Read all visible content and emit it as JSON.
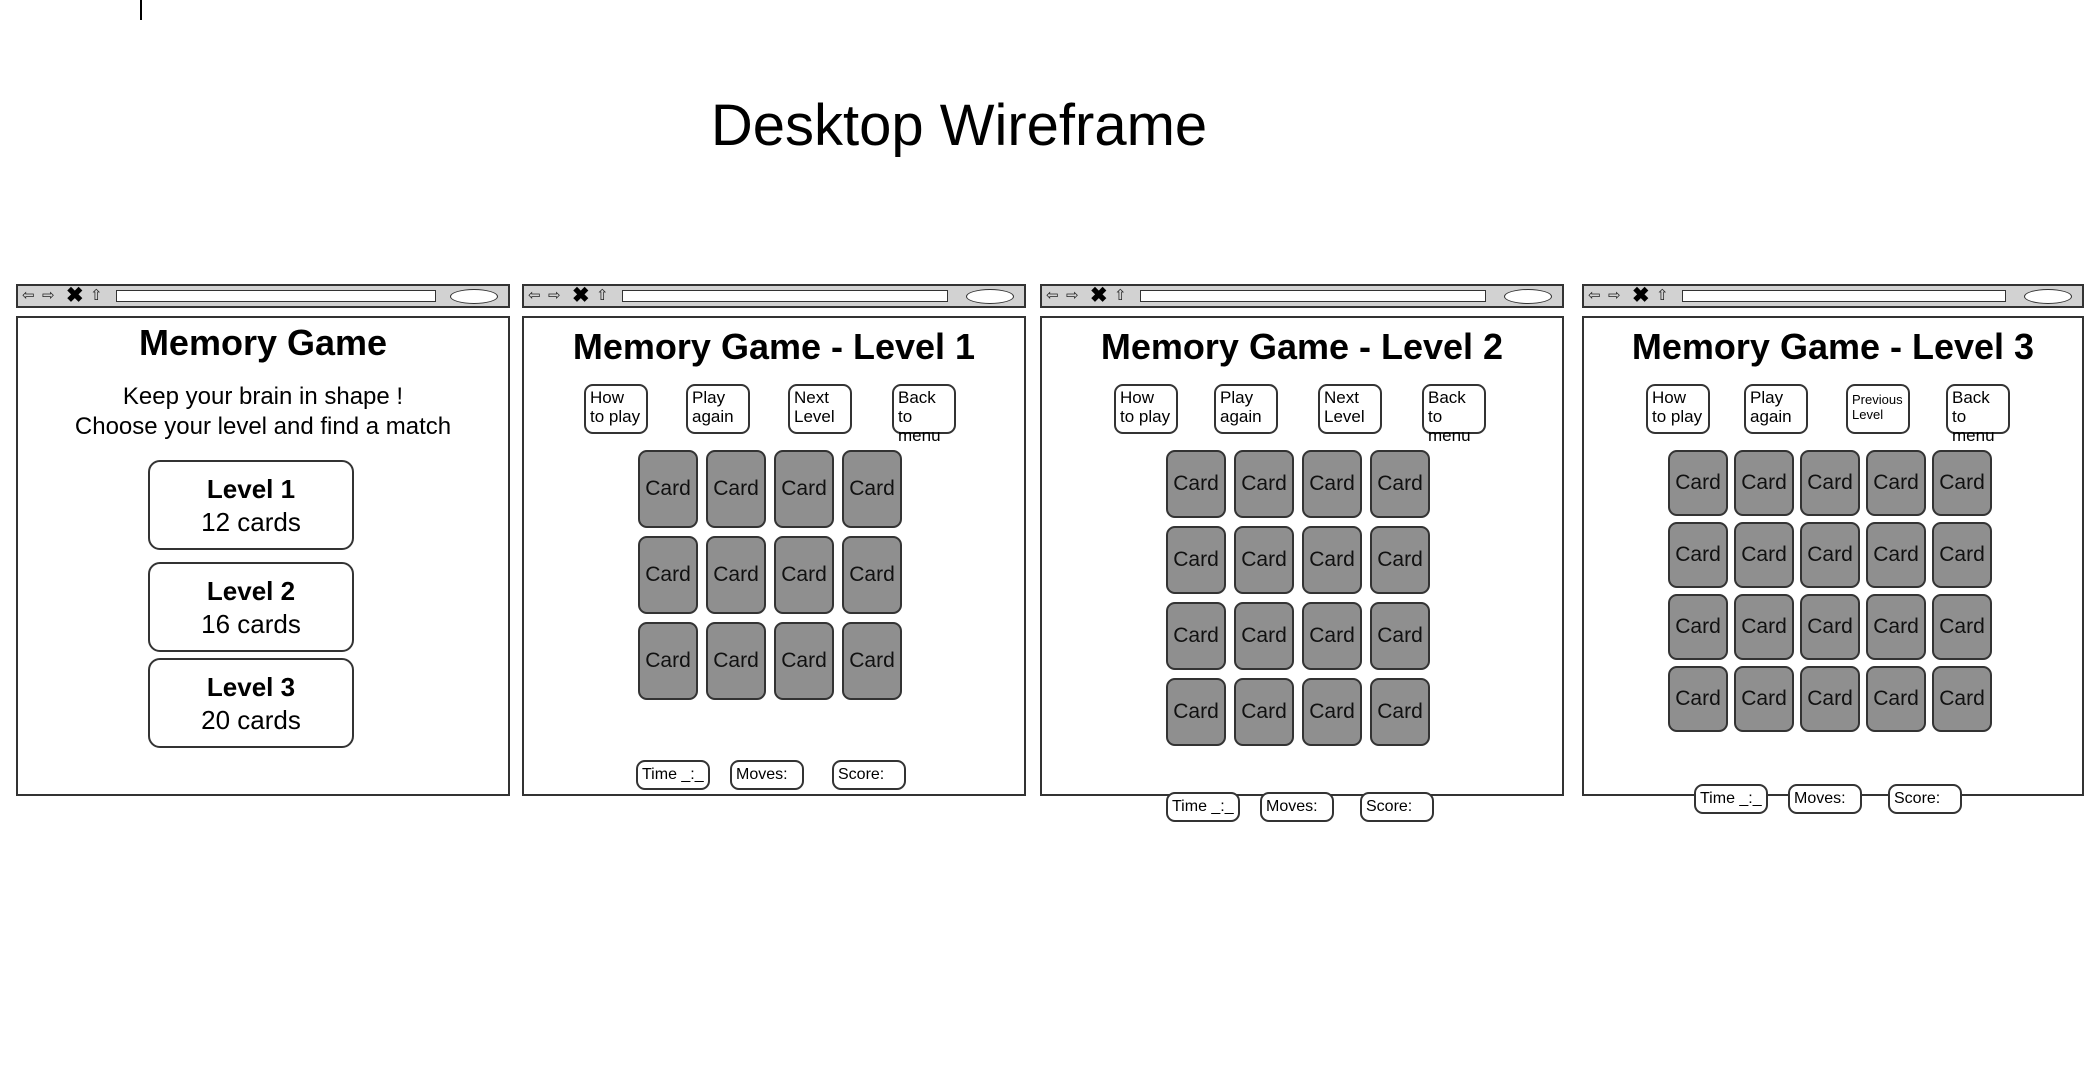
{
  "page": {
    "title": "Desktop Wireframe"
  },
  "menu_screen": {
    "title": "Memory Game",
    "tagline_1": "Keep your brain in shape !",
    "tagline_2": "Choose your level and find a match",
    "levels": [
      {
        "name": "Level 1",
        "cards": "12 cards"
      },
      {
        "name": "Level 2",
        "cards": "16 cards"
      },
      {
        "name": "Level 3",
        "cards": "20 cards"
      }
    ]
  },
  "game_screens": [
    {
      "title": "Memory Game - Level 1",
      "buttons": [
        "How to play",
        "Play again",
        "Next Level",
        "Back to menu"
      ],
      "columns": 4,
      "rows": 3,
      "card_label": "Card",
      "stats": [
        "Time _:_",
        "Moves:",
        "Score:"
      ]
    },
    {
      "title": "Memory Game - Level 2",
      "buttons": [
        "How to play",
        "Play again",
        "Next Level",
        "Back to menu"
      ],
      "columns": 4,
      "rows": 4,
      "card_label": "Card",
      "stats": [
        "Time _:_",
        "Moves:",
        "Score:"
      ]
    },
    {
      "title": "Memory Game - Level 3",
      "buttons": [
        "How to play",
        "Play again",
        "Previous Level",
        "Back to menu"
      ],
      "columns": 5,
      "rows": 4,
      "card_label": "Card",
      "stats": [
        "Time _:_",
        "Moves:",
        "Score:"
      ]
    }
  ],
  "colors": {
    "card_fill": "#8f8f8f",
    "toolbar": "#d2d2d2",
    "border": "#333333"
  },
  "icons": [
    "back-arrow-icon",
    "forward-arrow-icon",
    "close-icon",
    "home-icon",
    "search-oval-icon"
  ]
}
